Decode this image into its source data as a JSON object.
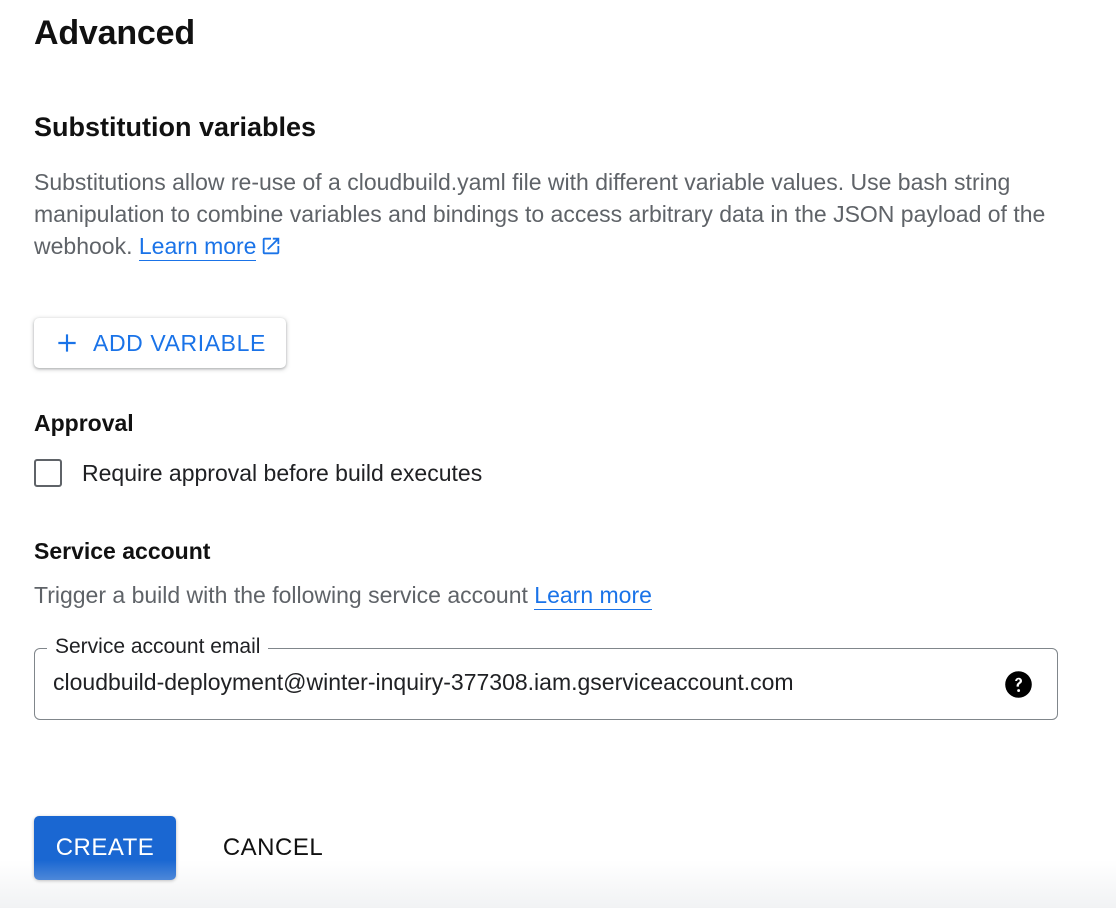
{
  "page": {
    "title": "Advanced"
  },
  "substitution": {
    "title": "Substitution variables",
    "description": "Substitutions allow re-use of a cloudbuild.yaml file with different variable values. Use bash string manipulation to combine variables and bindings to access arbitrary data in the JSON payload of the webhook.",
    "learn_more": "Learn more",
    "external_icon": "open-in-new-icon",
    "add_variable_label": "ADD VARIABLE",
    "add_icon": "plus-icon"
  },
  "approval": {
    "title": "Approval",
    "checkbox_label": "Require approval before build executes",
    "checked": false
  },
  "service_account": {
    "title": "Service account",
    "description": "Trigger a build with the following service account",
    "learn_more": "Learn more",
    "field_label": "Service account email",
    "field_value": "cloudbuild-deployment@winter-inquiry-377308.iam.gserviceaccount.com",
    "help_icon": "help-circle-icon"
  },
  "actions": {
    "create_label": "CREATE",
    "cancel_label": "CANCEL"
  },
  "colors": {
    "accent": "#1a73e8",
    "primary_button": "#1a67d2",
    "muted_text": "#5f6368"
  }
}
